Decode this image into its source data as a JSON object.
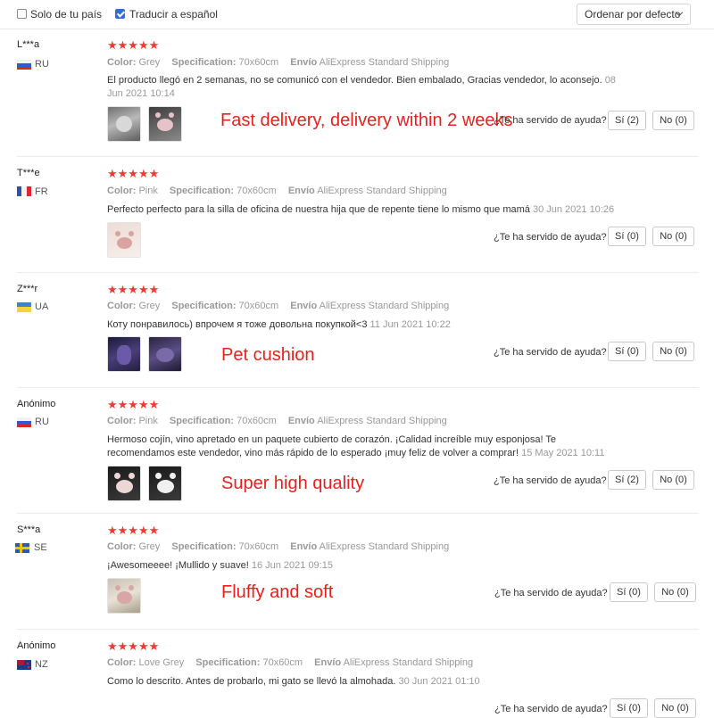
{
  "filters": {
    "only_country_label": "Solo de tu país",
    "translate_label": "Traducir a español",
    "translate_checked": true,
    "sort_label": "Ordenar por defecto"
  },
  "labels": {
    "color": "Color:",
    "spec": "Specification:",
    "ship": "Envío",
    "helpful": "¿Te ha servido de ayuda?"
  },
  "accent_color": "#e8211b",
  "reviews": [
    {
      "name": "L***a",
      "country": "RU",
      "stars": "★★★★★",
      "color": "Grey",
      "spec": "70x60cm",
      "ship": "AliExpress Standard Shipping",
      "text": "El producto llegó en 2 semanas, no se comunicó con el vendedor. Bien embalado, Gracias vendedor, lo aconsejo.",
      "date": "08 Jun 2021 10:14",
      "overlay": "Fast delivery, delivery within 2 weeks",
      "yes": "Sí (2)",
      "no": "No (0)"
    },
    {
      "name": "T***e",
      "country": "FR",
      "stars": "★★★★★",
      "color": "Pink",
      "spec": "70x60cm",
      "ship": "AliExpress Standard Shipping",
      "text": "Perfecto perfecto para la silla de oficina de nuestra hija que de repente tiene lo mismo que mamá",
      "date": "30 Jun 2021 10:26",
      "overlay": "",
      "yes": "Sí (0)",
      "no": "No (0)"
    },
    {
      "name": "Z***r",
      "country": "UA",
      "stars": "★★★★★",
      "color": "Grey",
      "spec": "70x60cm",
      "ship": "AliExpress Standard Shipping",
      "text": "Коту понравилось) впрочем я тоже довольна покупкой<3",
      "date": "11 Jun 2021 10:22",
      "overlay": "Pet cushion",
      "yes": "Sí (0)",
      "no": "No (0)"
    },
    {
      "name": "Anónimo",
      "country": "RU",
      "stars": "★★★★★",
      "color": "Pink",
      "spec": "70x60cm",
      "ship": "AliExpress Standard Shipping",
      "text": "Hermoso cojín, vino apretado en un paquete cubierto de corazón. ¡Calidad increíble muy esponjosa! Te recomendamos este vendedor, vino más rápido de lo esperado ¡muy feliz de volver a comprar!",
      "date": "15 May 2021 10:11",
      "overlay": "Super high quality",
      "yes": "Sí (2)",
      "no": "No (0)"
    },
    {
      "name": "S***a",
      "country": "SE",
      "stars": "★★★★★",
      "color": "Grey",
      "spec": "70x60cm",
      "ship": "AliExpress Standard Shipping",
      "text": "¡Awesomeeee! ¡Mullido y suave!",
      "date": "16 Jun 2021 09:15",
      "overlay": "Fluffy and soft",
      "yes": "Sí (0)",
      "no": "No (0)"
    },
    {
      "name": "Anónimo",
      "country": "NZ",
      "stars": "★★★★★",
      "color": "Love Grey",
      "spec": "70x60cm",
      "ship": "AliExpress Standard Shipping",
      "text": "Como lo descrito. Antes de probarlo, mi gato se llevó la almohada.",
      "date": "30 Jun 2021 01:10",
      "overlay": "",
      "yes": "Sí (0)",
      "no": "No (0)"
    }
  ]
}
